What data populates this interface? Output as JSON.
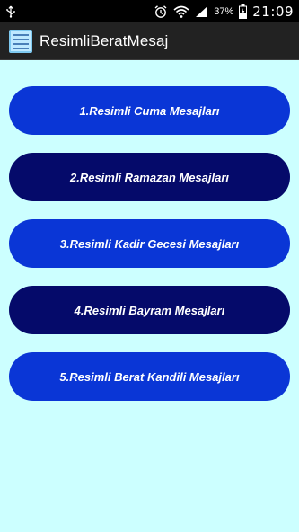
{
  "status_bar": {
    "usb_icon": "usb-icon",
    "alarm_icon": "alarm-icon",
    "wifi_icon": "wifi-icon",
    "signal_icon": "signal-icon",
    "battery_percent": "37%",
    "battery_icon": "battery-charging-icon",
    "time": "21:09"
  },
  "action_bar": {
    "title": "ResimliBeratMesaj",
    "icon": "app-icon"
  },
  "menu": {
    "items": [
      {
        "label": "1.Resimli Cuma Mesajları",
        "color": "#0a36d6"
      },
      {
        "label": "2.Resimli Ramazan Mesajları",
        "color": "#050a6a"
      },
      {
        "label": "3.Resimli Kadir Gecesi Mesajları",
        "color": "#0a36d6"
      },
      {
        "label": "4.Resimli Bayram Mesajları",
        "color": "#050a6a"
      },
      {
        "label": "5.Resimli Berat Kandili Mesajları",
        "color": "#0a36d6"
      }
    ]
  },
  "colors": {
    "background": "#ccffff",
    "action_bar": "#222222",
    "status_bar": "#000000"
  }
}
